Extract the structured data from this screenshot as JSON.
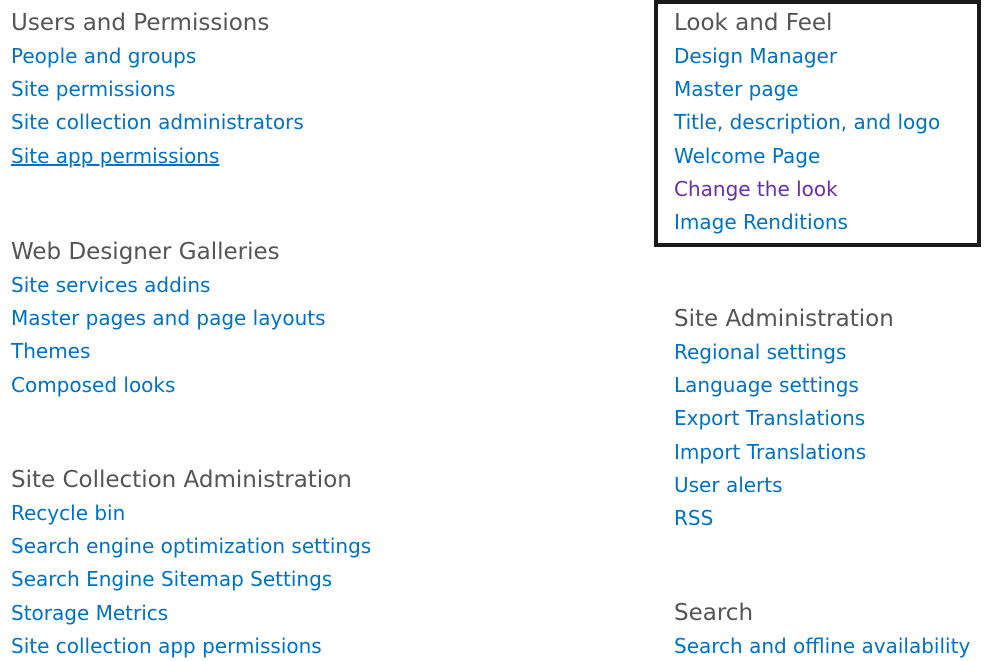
{
  "colors": {
    "link": "#0072c6",
    "visited_link": "#6a2fa8",
    "heading": "#555555",
    "highlight_border": "#1a1a1a"
  },
  "sections": {
    "users_permissions": {
      "title": "Users and Permissions",
      "links": [
        "People and groups",
        "Site permissions",
        "Site collection administrators",
        "Site app permissions"
      ]
    },
    "web_designer_galleries": {
      "title": "Web Designer Galleries",
      "links": [
        "Site services addins",
        "Master pages and page layouts",
        "Themes",
        "Composed looks"
      ]
    },
    "site_collection_administration": {
      "title": "Site Collection Administration",
      "links": [
        "Recycle bin",
        "Search engine optimization settings",
        "Search Engine Sitemap Settings",
        "Storage Metrics",
        "Site collection app permissions"
      ]
    },
    "look_and_feel": {
      "title": "Look and Feel",
      "links": [
        "Design Manager",
        "Master page",
        "Title, description, and logo",
        "Welcome Page",
        "Change the look",
        "Image Renditions"
      ]
    },
    "site_administration": {
      "title": "Site Administration",
      "links": [
        "Regional settings",
        "Language settings",
        "Export Translations",
        "Import Translations",
        "User alerts",
        "RSS"
      ]
    },
    "search": {
      "title": "Search",
      "links": [
        "Search and offline availability"
      ]
    }
  }
}
